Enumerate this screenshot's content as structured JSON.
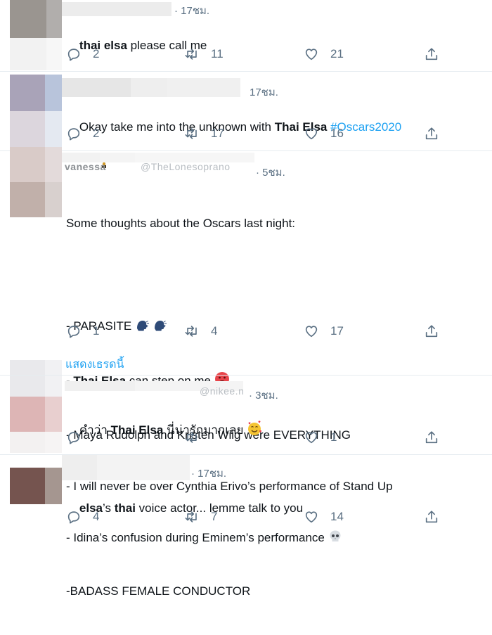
{
  "colors": {
    "accent": "#1da1f2",
    "secondary_text": "#5b7083",
    "divider": "#e6ecf0"
  },
  "tweets": [
    {
      "time": "· 17ชม.",
      "text_parts": [
        {
          "b": "thai elsa"
        },
        {
          "t": " please call me"
        }
      ],
      "reply_count": "2",
      "retweet_count": "11",
      "like_count": "21"
    },
    {
      "time": "17ชม.",
      "text_parts": [
        {
          "t": "Okay take me into the unknown with "
        },
        {
          "b": "Thai Elsa"
        },
        {
          "t": " "
        },
        {
          "h": "#Oscars2020"
        }
      ],
      "reply_count": "2",
      "retweet_count": "17",
      "like_count": "16"
    },
    {
      "name_fragment": "vanessa",
      "handle_fragment": "@TheLonesoprano",
      "time": "· 5ชม.",
      "lines": [
        [
          {
            "t": "Some thoughts about the Oscars last night:"
          }
        ],
        [],
        [
          {
            "t": "- PARASITE "
          }
        ],
        [
          {
            "t": "- "
          },
          {
            "b": "Thai Elsa"
          },
          {
            "t": " can step on me "
          }
        ],
        [
          {
            "t": "- Maya Rudolph and Kristen Wiig were EVERYTHING"
          }
        ],
        [
          {
            "t": "- I will never be over Cynthia Erivo’s performance of Stand Up"
          }
        ],
        [
          {
            "t": "- Idina’s confusion during Eminem’s performance "
          }
        ],
        [
          {
            "t": "-BADASS FEMALE CONDUCTOR"
          }
        ]
      ],
      "reply_count": "1",
      "retweet_count": "4",
      "like_count": "17"
    },
    {
      "handle_fragment": "@nikee.n",
      "time": "· 3ชม.",
      "text_parts": [
        {
          "t": "คำว่า "
        },
        {
          "b": "Thai Elsa"
        },
        {
          "t": " นี่น่ารักมากเลย "
        }
      ],
      "reply_count": "",
      "retweet_count": "",
      "like_count": "1"
    },
    {
      "time": "· 17ชม.",
      "text_parts": [
        {
          "b": "elsa"
        },
        {
          "t": "’s "
        },
        {
          "b": "thai"
        },
        {
          "t": " voice actor... lemme talk to you"
        }
      ],
      "reply_count": "4",
      "retweet_count": "7",
      "like_count": "14"
    }
  ],
  "show_thread_label": "แสดงเธรดนี้",
  "icons": [
    "reply-icon",
    "retweet-icon",
    "like-icon",
    "share-icon",
    "oscar-trophy-emoji",
    "speaking-head-emoji",
    "hot-face-emoji",
    "skull-emoji",
    "smiling-face-with-hearts-emoji"
  ]
}
